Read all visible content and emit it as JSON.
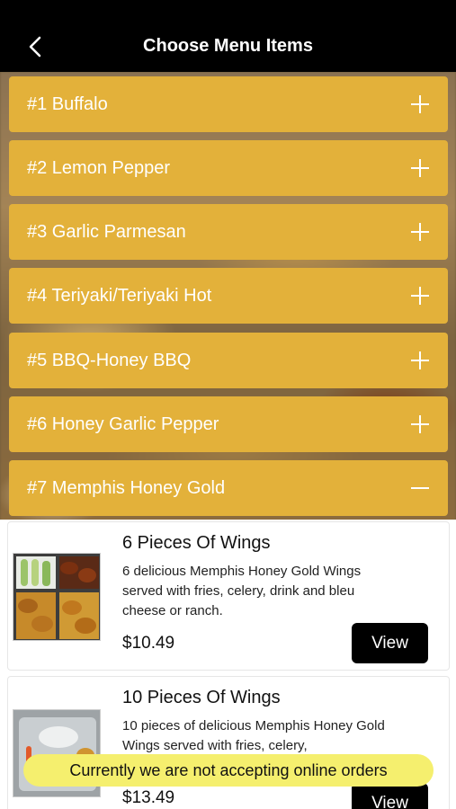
{
  "header": {
    "title": "Choose Menu Items",
    "back_icon": "chevron-left-icon"
  },
  "categories": [
    {
      "label": "#1 Buffalo",
      "state": "collapsed"
    },
    {
      "label": "#2 Lemon Pepper",
      "state": "collapsed"
    },
    {
      "label": "#3 Garlic Parmesan",
      "state": "collapsed"
    },
    {
      "label": "#4 Teriyaki/Teriyaki Hot",
      "state": "collapsed"
    },
    {
      "label": "#5 BBQ-Honey BBQ",
      "state": "collapsed"
    },
    {
      "label": "#6 Honey Garlic Pepper",
      "state": "collapsed"
    },
    {
      "label": "#7 Memphis Honey Gold",
      "state": "expanded"
    }
  ],
  "items": [
    {
      "title": "6 Pieces Of Wings",
      "description": "6 delicious Memphis Honey Gold Wings  served with fries, celery, drink and bleu cheese or ranch.",
      "price": "$10.49",
      "button": "View"
    },
    {
      "title": "10 Pieces Of Wings",
      "description": "10 pieces of delicious Memphis Honey Gold Wings  served with fries, celery,",
      "price": "$13.49",
      "button": "View"
    }
  ],
  "notice": "Currently we are not accepting online orders",
  "colors": {
    "category_bg": "#e3b13a",
    "header_bg": "#000000",
    "notice_bg": "#f5ef6e",
    "button_bg": "#000000"
  }
}
